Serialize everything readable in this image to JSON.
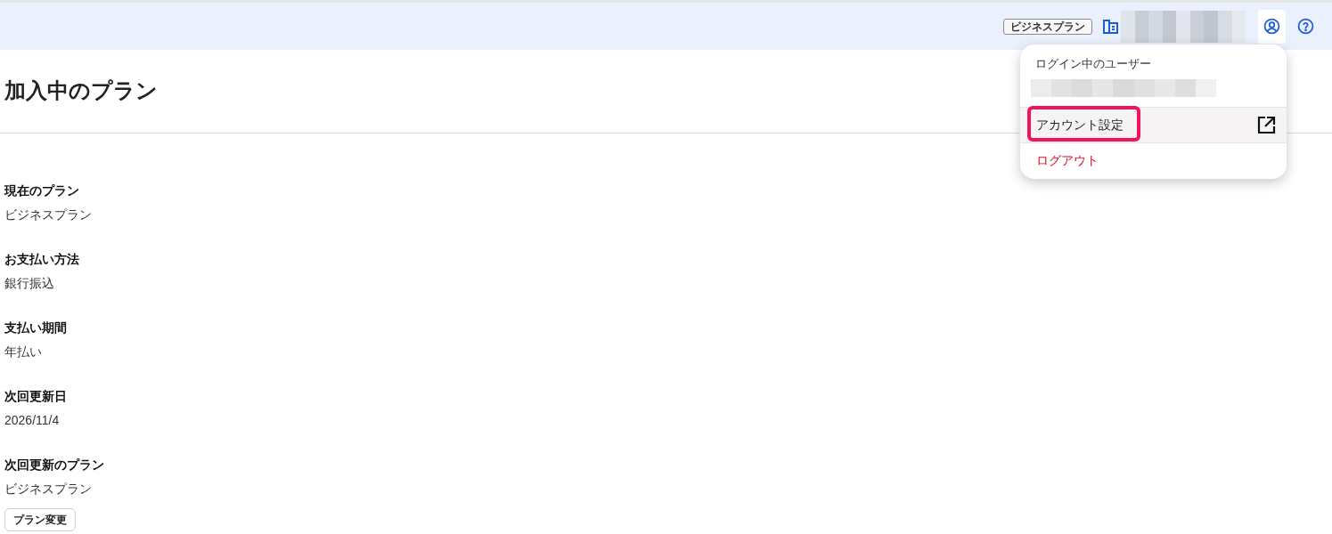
{
  "header": {
    "plan_badge": "ビジネスプラン",
    "account_button": {
      "active": true
    }
  },
  "page": {
    "title": "加入中のプラン"
  },
  "details": [
    {
      "label": "現在のプラン",
      "value": "ビジネスプラン"
    },
    {
      "label": "お支払い方法",
      "value": "銀行振込"
    },
    {
      "label": "支払い期間",
      "value": "年払い"
    },
    {
      "label": "次回更新日",
      "value": "2026/11/4"
    },
    {
      "label": "次回更新のプラン",
      "value": "ビジネスプラン"
    }
  ],
  "change_plan_button": "プラン変更",
  "account_menu": {
    "open": true,
    "heading": "ログイン中のユーザー",
    "items": [
      {
        "label": "アカウント設定",
        "kind": "external",
        "selected": true,
        "highlighted": true
      },
      {
        "label": "ログアウト",
        "kind": "danger",
        "selected": false,
        "highlighted": false
      }
    ]
  }
}
